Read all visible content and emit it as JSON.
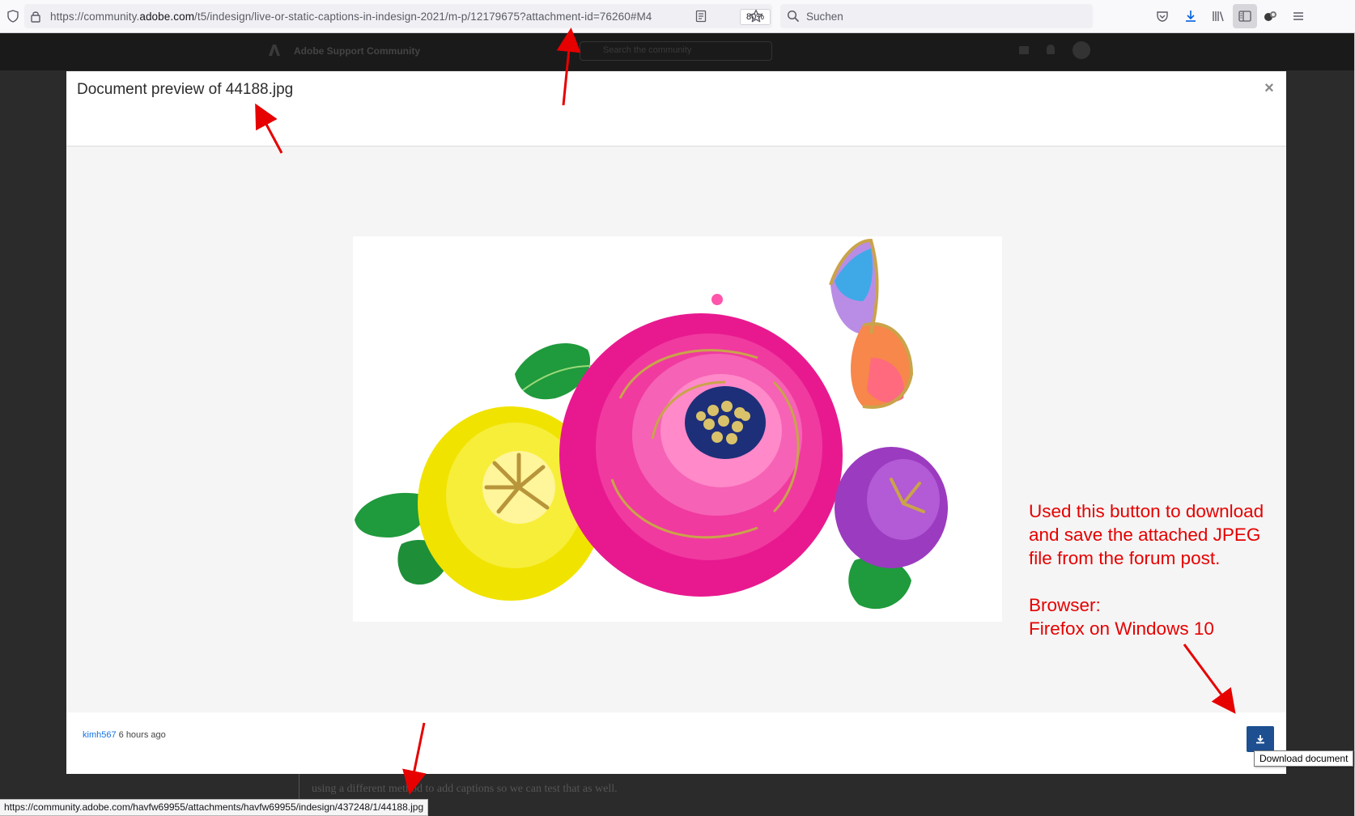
{
  "browser": {
    "url_host_prefix": "https://community.",
    "url_host_domain": "adobe.com",
    "url_path": "/t5/indesign/live-or-static-captions-in-indesign-2021/m-p/12179675?attachment-id=76260#M4",
    "zoom": "80%",
    "search_placeholder": "Suchen"
  },
  "background_page": {
    "site_title": "Adobe Support Community",
    "search_placeholder": "Search the community",
    "footer_text": "using a different method to add captions so we can test that as well."
  },
  "modal": {
    "title": "Document preview of 44188.jpg",
    "close_label": "×",
    "author": "kimh567",
    "time": "6 hours ago",
    "download_tooltip": "Download document"
  },
  "annotation": {
    "lines": [
      "Used this button to download",
      "and save the attached JPEG",
      "file from the forum post.",
      "",
      "Browser:",
      "Firefox on Windows 10"
    ],
    "color": "#e60000"
  },
  "status_bar": {
    "link": "https://community.adobe.com/havfw69955/attachments/havfw69955/indesign/437248/1/44188.jpg"
  },
  "icons": {
    "shield": "shield-icon",
    "lock": "lock-icon",
    "reader": "reader-view-icon",
    "star": "bookmark-star-icon",
    "search": "search-icon",
    "pocket": "pocket-icon",
    "downloads": "downloads-icon",
    "library": "library-icon",
    "sidebar": "sidebar-icon",
    "extensions": "extensions-icon",
    "menu": "hamburger-menu-icon",
    "download_doc": "download-icon",
    "close": "close-icon"
  }
}
